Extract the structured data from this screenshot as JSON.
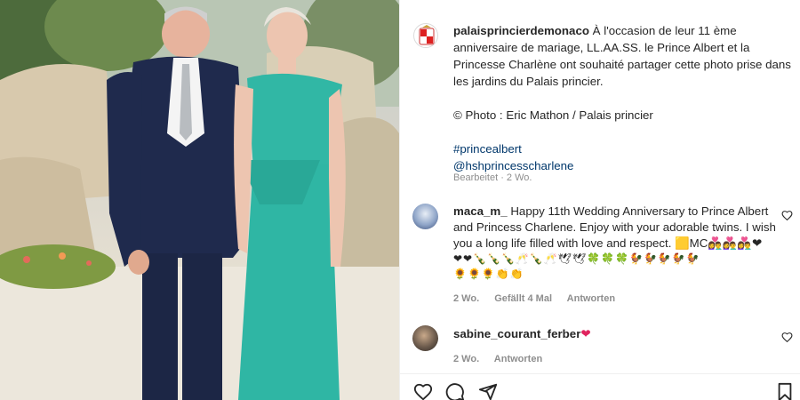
{
  "post": {
    "username": "palaisprincierdemonaco",
    "caption_lines": [
      "À l'occasion de leur 11 ème anniversaire de mariage, LL.AA.SS. le Prince Albert et la Princesse Charlène ont souhaité partager cette photo prise dans les jardins du Palais princier."
    ],
    "credit": "© Photo : Eric Mathon / Palais princier",
    "hashtag": "#princealbert",
    "mention": "@hshprincesscharlene",
    "edited_label": "Bearbeitet · 2 Wo."
  },
  "comments": [
    {
      "username": "maca_m_",
      "text": "Happy 11th Wedding Anniversary to Prince Albert and Princess Charlene. Enjoy with your adorable twins. I wish you a long life filled with love and respect. 🟨MC👩‍❤️‍👨👩‍❤️‍👨👩‍❤️‍👨❤",
      "emoji_line_1": "❤❤🍾🍾🍾🥂🍾🥂🕊🕊🍀🍀🍀🐓🐓🐓🐓🐓",
      "emoji_line_2": "🌻🌻🌻👏👏",
      "age": "2 Wo.",
      "likes": "Gefällt 4 Mal",
      "reply": "Antworten"
    },
    {
      "username": "sabine_courant_ferber",
      "text": "❤",
      "age": "2 Wo.",
      "reply": "Antworten"
    }
  ],
  "icons": {
    "like": "heart-icon",
    "comment": "comment-icon",
    "share": "paper-plane-icon",
    "save": "bookmark-icon"
  },
  "colors": {
    "link": "#00376b",
    "muted": "#8e8e8e",
    "dress": "#2fb6a4",
    "suit": "#1f2a4d"
  }
}
